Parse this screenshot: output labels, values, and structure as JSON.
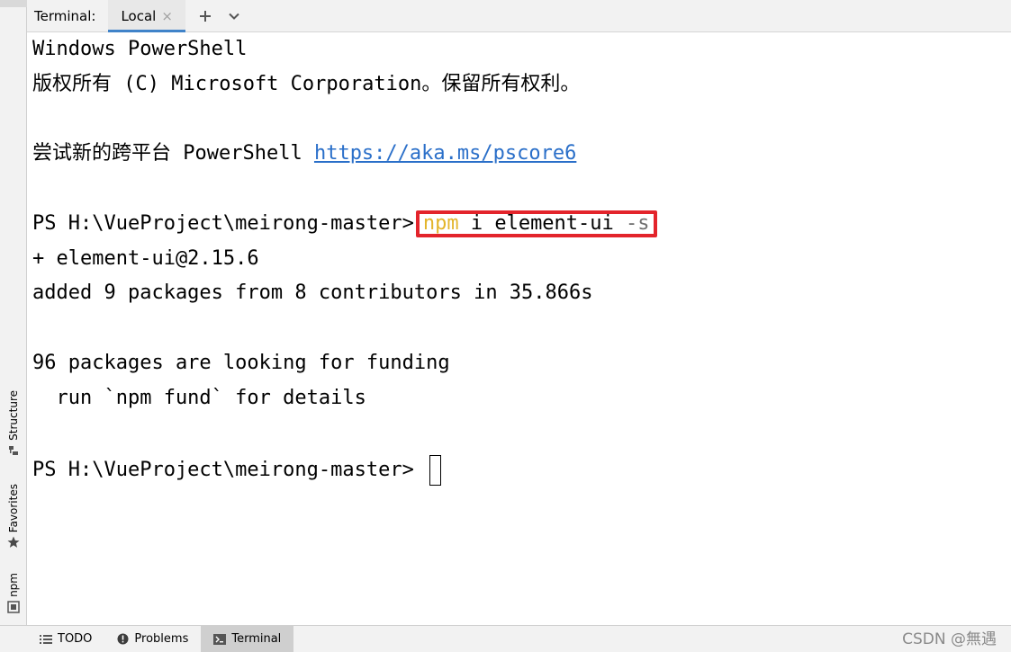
{
  "header": {
    "title": "Terminal:",
    "tab_label": "Local",
    "tab_close": "×",
    "add_icon": "plus-icon",
    "menu_icon": "chevron-down-icon"
  },
  "sidebar": {
    "items": [
      {
        "label": "Structure",
        "icon": "structure-icon"
      },
      {
        "label": "Favorites",
        "icon": "star-icon"
      },
      {
        "label": "npm",
        "icon": "npm-icon"
      }
    ]
  },
  "terminal": {
    "lines": {
      "l1": "Windows PowerShell",
      "l2": "版权所有 (C) Microsoft Corporation。保留所有权利。",
      "l3_text": "尝试新的跨平台 PowerShell ",
      "l3_link": "https://aka.ms/pscore6",
      "prompt1": "PS H:\\VueProject\\meirong-master>",
      "cmd_npm": "npm",
      "cmd_mid": " i element-ui ",
      "cmd_flag": "-s",
      "l5": "+ element-ui@2.15.6",
      "l6": "added 9 packages from 8 contributors in 35.866s",
      "l7": "96 packages are looking for funding",
      "l8": "  run `npm fund` for details",
      "prompt2": "PS H:\\VueProject\\meirong-master> "
    }
  },
  "bottom_bar": {
    "tabs": [
      {
        "label": "TODO",
        "icon": "list-icon"
      },
      {
        "label": "Problems",
        "icon": "info-icon"
      },
      {
        "label": "Terminal",
        "icon": "terminal-icon",
        "active": true
      }
    ],
    "watermark": "CSDN @無遇"
  },
  "colors": {
    "accent": "#4083c9",
    "highlight_box": "#e3242b",
    "npm_token": "#e3b52b",
    "link": "#2a6fc9"
  }
}
